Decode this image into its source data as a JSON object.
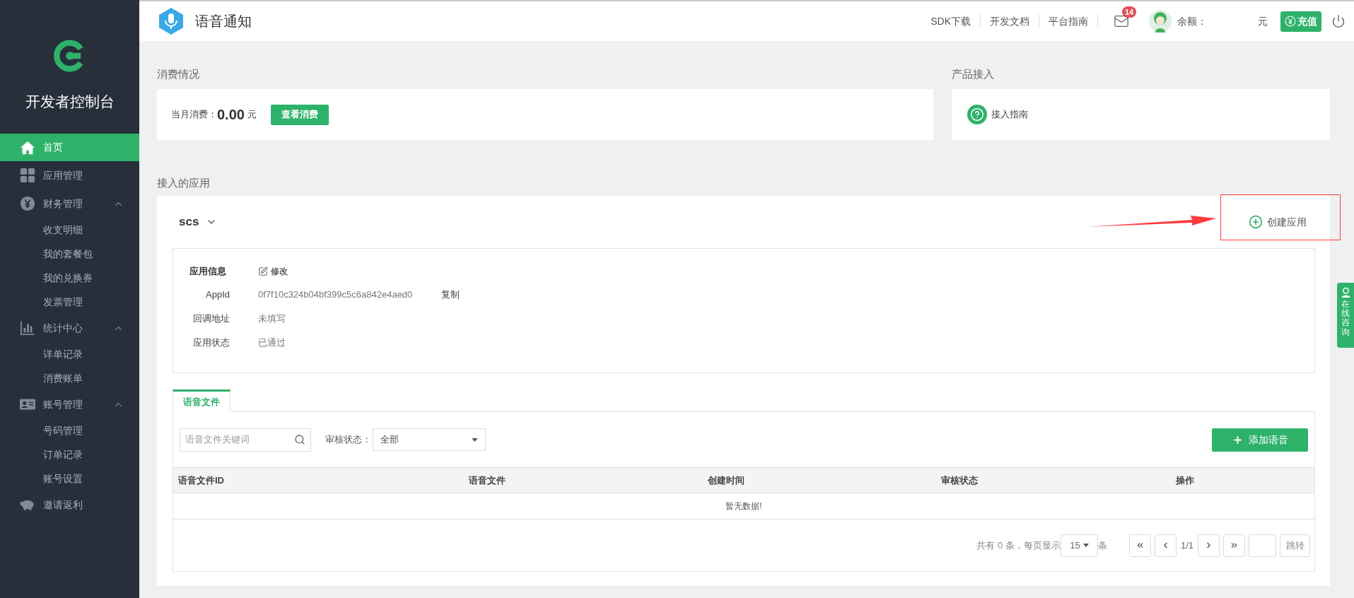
{
  "sidebar": {
    "title": "开发者控制台",
    "items": [
      {
        "label": "首页",
        "selected": true
      },
      {
        "label": "应用管理",
        "selected": false
      },
      {
        "label": "财务管理",
        "selected": false,
        "expanded": true,
        "children": [
          {
            "label": "收支明细",
            "selected": false
          },
          {
            "label": "我的套餐包",
            "selected": false
          },
          {
            "label": "我的兑换券",
            "selected": false
          },
          {
            "label": "发票管理",
            "selected": false
          }
        ]
      },
      {
        "label": "统计中心",
        "selected": false,
        "expanded": true,
        "children": [
          {
            "label": "详单记录",
            "selected": false
          },
          {
            "label": "消费账单",
            "selected": false
          }
        ]
      },
      {
        "label": "账号管理",
        "selected": false,
        "expanded": true,
        "children": [
          {
            "label": "号码管理",
            "selected": false
          },
          {
            "label": "订单记录",
            "selected": false
          },
          {
            "label": "账号设置",
            "selected": false
          }
        ]
      },
      {
        "label": "邀请返利",
        "selected": false
      }
    ]
  },
  "header": {
    "title": "语音通知",
    "links": [
      "SDK下载",
      "开发文档",
      "平台指南"
    ],
    "mail_badge": "14",
    "balance_label": "余额：",
    "balance_unit": "元",
    "recharge": "充值"
  },
  "consumption": {
    "title": "消费情况",
    "label": "当月消费：",
    "amount": "0.00",
    "unit": "元",
    "button": "查看消费"
  },
  "product": {
    "title": "产品接入",
    "link": "接入指南"
  },
  "apps": {
    "title": "接入的应用",
    "app_name": "scs",
    "create_button": "创建应用",
    "info": {
      "title": "应用信息",
      "edit": "修改",
      "fields": [
        {
          "label": "AppId",
          "value": "0f7f10c324b04bf399c5c6a842e4aed0",
          "action": "复制"
        },
        {
          "label": "回调地址",
          "value": "未填写"
        },
        {
          "label": "应用状态",
          "value": "已通过"
        }
      ]
    },
    "tabs": [
      {
        "label": "语音文件",
        "selected": true
      }
    ],
    "search": {
      "placeholder": "语音文件关键词"
    },
    "status_filter": {
      "label": "审核状态：",
      "value": "全部"
    },
    "add_button": "添加语音",
    "table": {
      "columns": [
        "语音文件ID",
        "语音文件",
        "创建时间",
        "审核状态",
        "操作"
      ],
      "empty": "暂无数据!"
    },
    "pagination": {
      "summary": "共有 0 条，每页显示",
      "page_size": "15",
      "unit": "条",
      "page": "1/1",
      "jump": "跳转"
    }
  },
  "consult": "在线咨询"
}
